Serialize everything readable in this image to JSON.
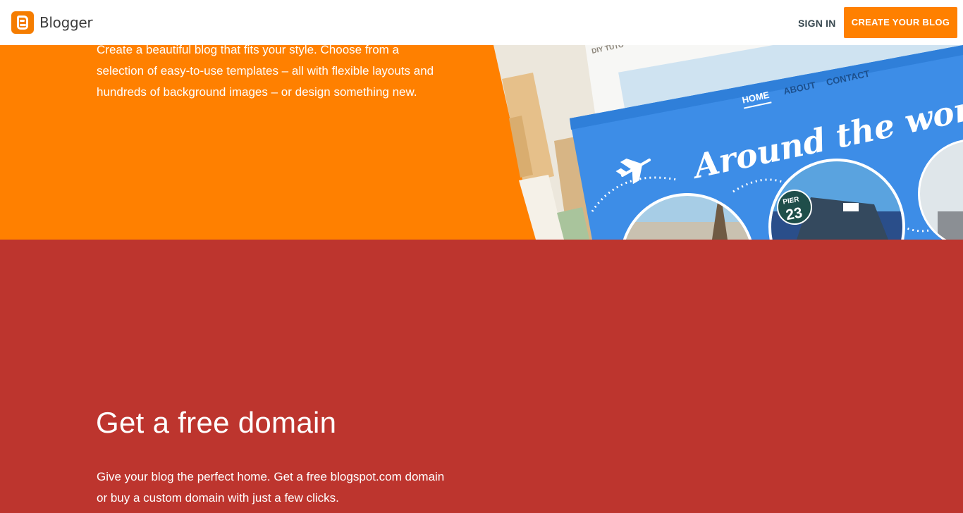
{
  "header": {
    "brand": "Blogger",
    "sign_in": "SIGN IN",
    "create_blog": "CREATE YOUR BLOG"
  },
  "templates_section": {
    "description": "Create a beautiful blog that fits your style. Choose from a selection of easy-to-use templates – all with flexible layouts and hundreds of background images – or design something new."
  },
  "hero_image": {
    "label_fragment": "DIY TUTO",
    "nav_items": [
      "HOME",
      "ABOUT",
      "CONTACT"
    ],
    "script_title": "Around the world",
    "badge_top": "PIER",
    "badge_number": "23"
  },
  "domain_section": {
    "title": "Get a free domain",
    "description": "Give your blog the perfect home. Get a free blogspot.com domain or buy a custom domain with just a few clicks."
  },
  "colors": {
    "orange": "#ff8000",
    "red": "#bd352e",
    "hero_blue": "#3d8de7"
  }
}
